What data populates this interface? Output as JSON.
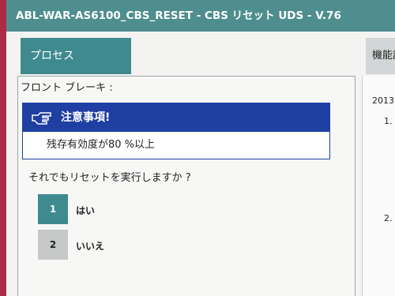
{
  "window": {
    "title": "ABL-WAR-AS6100_CBS_RESET - CBS リセット UDS - V.76"
  },
  "tabs": {
    "process": "プロセス",
    "function": "機能詳"
  },
  "section": {
    "label": "フロント ブレーキ :"
  },
  "notice": {
    "title": "注意事項!",
    "message": "残存有効度が80 %以上",
    "icon": "hand-pointing-icon"
  },
  "prompt": {
    "text": "それでもリセットを実行しますか ?"
  },
  "options": [
    {
      "key": "1",
      "label": "はい"
    },
    {
      "key": "2",
      "label": "いいえ"
    }
  ],
  "right_panel": {
    "year": "2013",
    "item1": "1.",
    "item2": "2."
  },
  "colors": {
    "titlebar": "#4f8e8e",
    "tab_active": "#3f8a8e",
    "notice_blue": "#1f3fa3",
    "option_inactive": "#c6c8c8"
  }
}
